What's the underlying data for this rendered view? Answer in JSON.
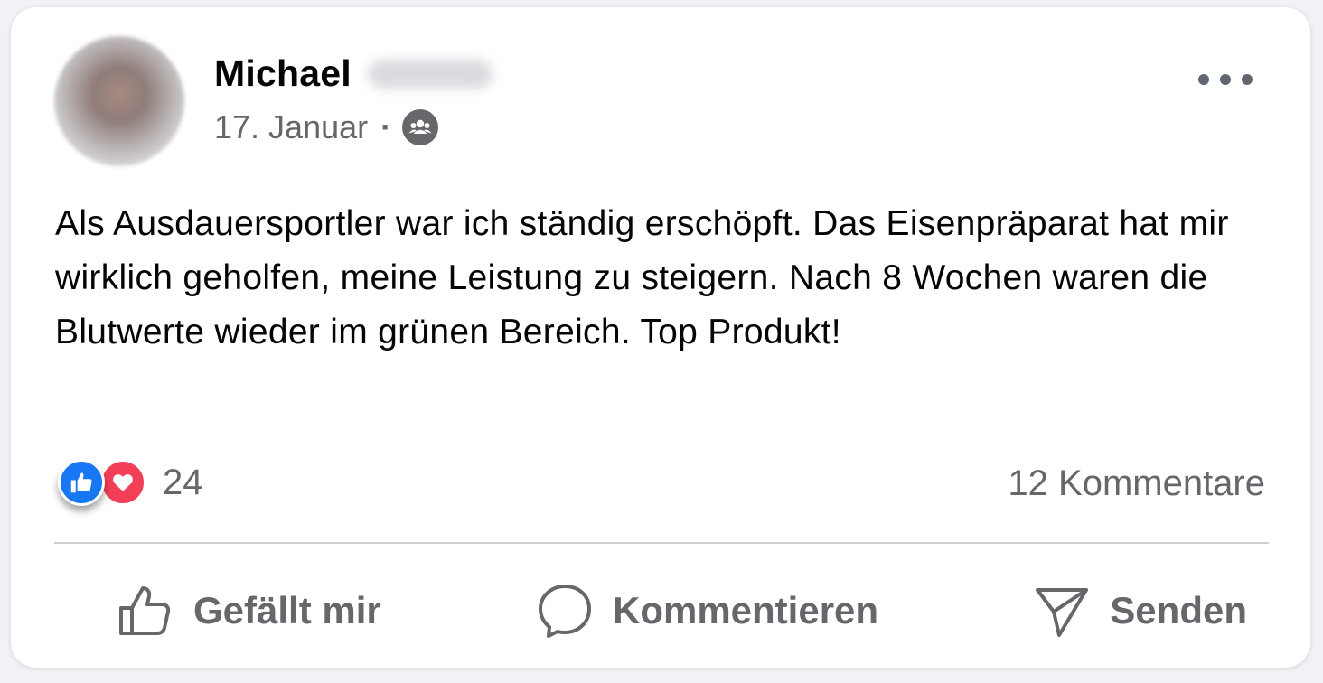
{
  "post": {
    "author_first_name": "Michael",
    "date": "17. Januar",
    "separator": "·",
    "audience_icon": "friends-icon",
    "text": "Als Ausdauersportler war ich ständig erschöpft. Das Eisenpräparat hat mir wirklich geholfen, meine Leistung zu steigern. Nach 8 Wochen waren die Blutwerte wieder im grünen Bereich. Top Produkt!",
    "reaction_count": "24",
    "comments_label": "12 Kommentare"
  },
  "actions": {
    "like_label": "Gefällt mir",
    "comment_label": "Kommentieren",
    "send_label": "Senden"
  },
  "colors": {
    "like_blue": "#1877f2",
    "love_red": "#f33e58",
    "secondary_text": "#65676b",
    "primary_text": "#050505"
  }
}
